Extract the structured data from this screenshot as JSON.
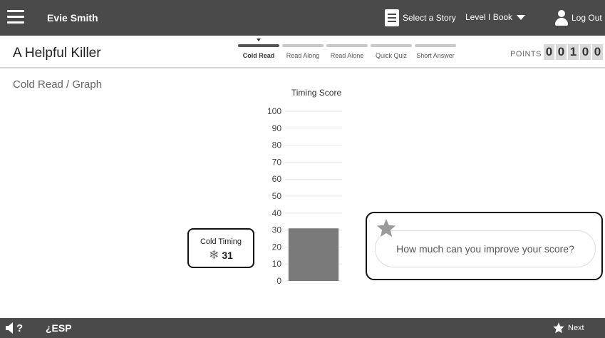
{
  "header": {
    "user_name": "Evie Smith",
    "select_story_label": "Select a Story",
    "level_label": "Level I Book",
    "logout_label": "Log Out"
  },
  "subheader": {
    "story_title": "A Helpful Killer",
    "steps": [
      {
        "label": "Cold Read",
        "active": true
      },
      {
        "label": "Read Along",
        "active": false
      },
      {
        "label": "Read Alone",
        "active": false
      },
      {
        "label": "Quick Quiz",
        "active": false
      },
      {
        "label": "Short Answer",
        "active": false
      }
    ],
    "points_label": "POINTS",
    "points_digits": [
      "0",
      "0",
      "1",
      "0",
      "0"
    ]
  },
  "main": {
    "section_title": "Cold Read / Graph",
    "cold_timing": {
      "label": "Cold Timing",
      "value": "31",
      "icon": "snowflake-icon"
    },
    "improve_prompt": "How much can you improve your score?"
  },
  "chart_data": {
    "type": "bar",
    "title": "Timing Score",
    "categories": [
      "Cold Timing"
    ],
    "values": [
      31
    ],
    "ylim": [
      0,
      100
    ],
    "yticks": [
      0,
      10,
      20,
      30,
      40,
      50,
      60,
      70,
      80,
      90,
      100
    ],
    "grid": true,
    "bar_color": "#7a7a7a"
  },
  "footer": {
    "esp_label": "¿ESP",
    "next_label": "Next"
  },
  "colors": {
    "bar_background": "#4a4a4a",
    "active_step": "#555555",
    "inactive_step": "#c9c9c9",
    "star": "#9a9a9a"
  }
}
